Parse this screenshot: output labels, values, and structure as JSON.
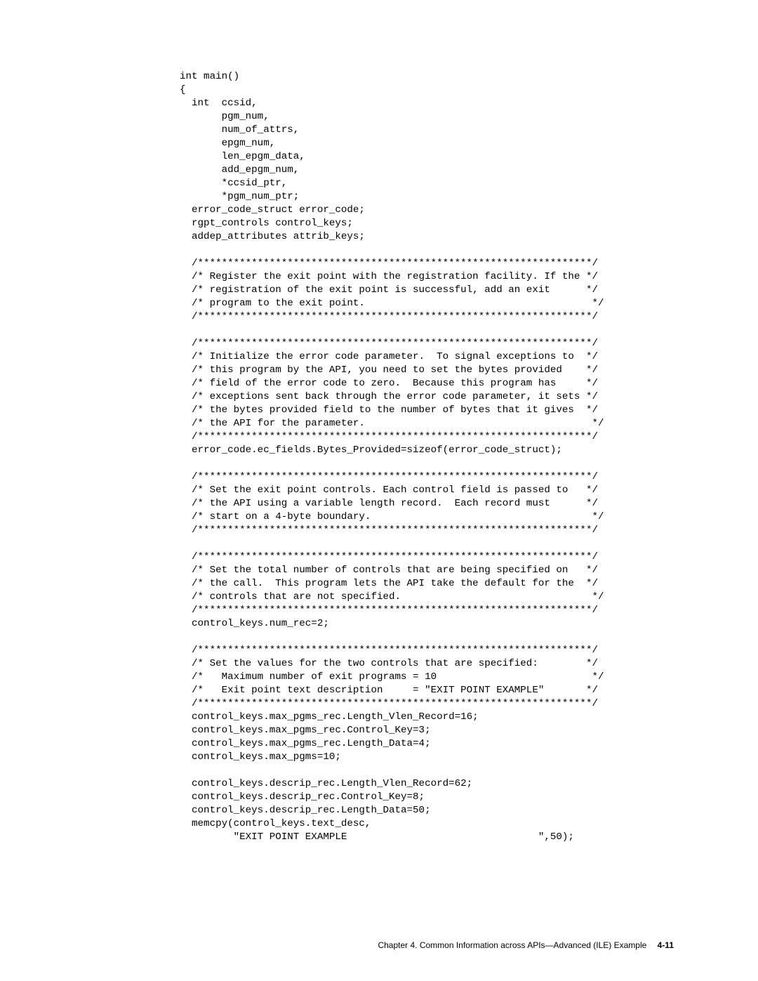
{
  "footer": {
    "chapter_text": "Chapter 4.  Common Information across APIs—Advanced (ILE) Example",
    "page_number": "4-11"
  },
  "code_lines": [
    "int main()",
    "{",
    "  int  ccsid,",
    "       pgm_num,",
    "       num_of_attrs,",
    "       epgm_num,",
    "       len_epgm_data,",
    "       add_epgm_num,",
    "       *ccsid_ptr,",
    "       *pgm_num_ptr;",
    "  error_code_struct error_code;",
    "  rgpt_controls control_keys;",
    "  addep_attributes attrib_keys;",
    "",
    "  /******************************************************************/",
    "  /* Register the exit point with the registration facility. If the */",
    "  /* registration of the exit point is successful, add an exit      */",
    "  /* program to the exit point.                                      */",
    "  /******************************************************************/",
    "",
    "  /******************************************************************/",
    "  /* Initialize the error code parameter.  To signal exceptions to  */",
    "  /* this program by the API, you need to set the bytes provided    */",
    "  /* field of the error code to zero.  Because this program has     */",
    "  /* exceptions sent back through the error code parameter, it sets */",
    "  /* the bytes provided field to the number of bytes that it gives  */",
    "  /* the API for the parameter.                                      */",
    "  /******************************************************************/",
    "  error_code.ec_fields.Bytes_Provided=sizeof(error_code_struct);",
    "",
    "  /******************************************************************/",
    "  /* Set the exit point controls. Each control field is passed to   */",
    "  /* the API using a variable length record.  Each record must      */",
    "  /* start on a 4-byte boundary.                                     */",
    "  /******************************************************************/",
    "",
    "  /******************************************************************/",
    "  /* Set the total number of controls that are being specified on   */",
    "  /* the call.  This program lets the API take the default for the  */",
    "  /* controls that are not specified.                                */",
    "  /******************************************************************/",
    "  control_keys.num_rec=2;",
    "",
    "  /******************************************************************/",
    "  /* Set the values for the two controls that are specified:        */",
    "  /*   Maximum number of exit programs = 10                          */",
    "  /*   Exit point text description     = \"EXIT POINT EXAMPLE\"       */",
    "  /******************************************************************/",
    "  control_keys.max_pgms_rec.Length_Vlen_Record=16;",
    "  control_keys.max_pgms_rec.Control_Key=3;",
    "  control_keys.max_pgms_rec.Length_Data=4;",
    "  control_keys.max_pgms=10;",
    "",
    "  control_keys.descrip_rec.Length_Vlen_Record=62;",
    "  control_keys.descrip_rec.Control_Key=8;",
    "  control_keys.descrip_rec.Length_Data=50;",
    "  memcpy(control_keys.text_desc,",
    "         \"EXIT POINT EXAMPLE                                \",50);"
  ]
}
